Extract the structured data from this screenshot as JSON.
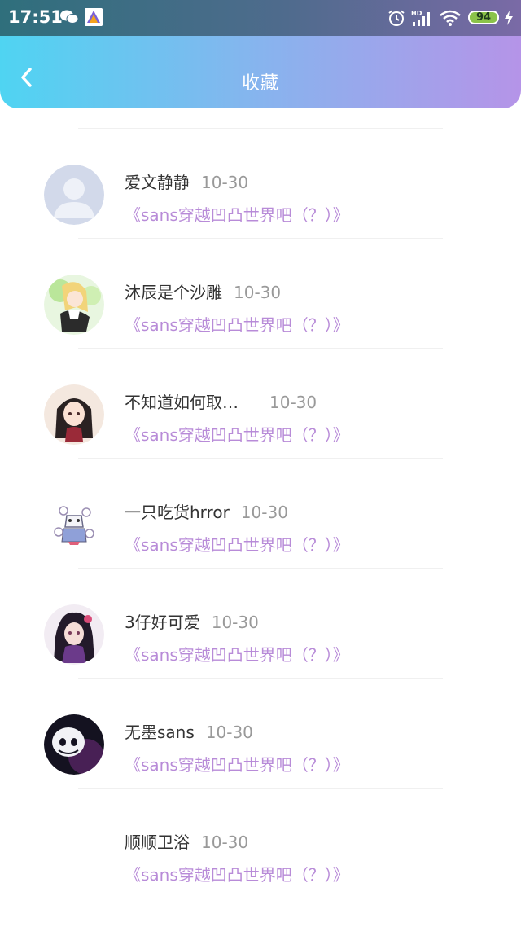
{
  "status_bar": {
    "time": "17:51",
    "battery": "94",
    "icons": [
      "wechat-icon",
      "app-icon",
      "alarm-icon",
      "hd-signal-icon",
      "wifi-icon",
      "battery-icon",
      "charging-icon"
    ]
  },
  "header": {
    "title": "收藏",
    "back_icon": "chevron-left-icon",
    "gradient": [
      "#4fd4f2",
      "#b594e8"
    ]
  },
  "accent": "#b88bd8",
  "favorites": [
    {
      "user": "爱文静静",
      "date": "10-30",
      "title": "《sans穿越凹凸世界吧（？）》",
      "avatar": "default-avatar"
    },
    {
      "user": "沐辰是个沙雕",
      "date": "10-30",
      "title": "《sans穿越凹凸世界吧（？）》",
      "avatar": "anime-girl-blonde"
    },
    {
      "user": "不知道如何取…",
      "date": "10-30",
      "title": "《sans穿越凹凸世界吧（？）》",
      "avatar": "anime-girl-black-hair"
    },
    {
      "user": "一只吃货hrror",
      "date": "10-30",
      "title": "《sans穿越凹凸世界吧（？）》",
      "avatar": "skeleton-sketch"
    },
    {
      "user": "3仔好可爱",
      "date": "10-30",
      "title": "《sans穿越凹凸世界吧（？）》",
      "avatar": "anime-girl-purple"
    },
    {
      "user": "无墨sans",
      "date": "10-30",
      "title": "《sans穿越凹凸世界吧（？）》",
      "avatar": "sans-dark"
    },
    {
      "user": "顺顺卫浴",
      "date": "10-30",
      "title": "《sans穿越凹凸世界吧（？）》",
      "avatar": "blank"
    }
  ]
}
